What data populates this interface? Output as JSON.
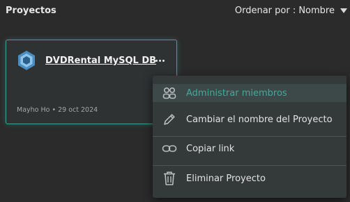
{
  "header": {
    "title": "Proyectos",
    "sort_label": "Ordenar por : Nombre"
  },
  "project_card": {
    "name": "DVDRental MySQL DB",
    "owner": "Mayho Ho",
    "date": "29 oct 2024",
    "meta": "Mayho Ho • 29 oct 2024",
    "logo_icon": "mysql-hexagon-logo",
    "more_icon": "ellipsis-icon"
  },
  "context_menu": {
    "items": [
      {
        "label": "Administrar miembros",
        "icon": "members-icon",
        "active": true
      },
      {
        "label": "Cambiar el nombre del Proyecto",
        "icon": "pencil-icon",
        "active": false
      },
      {
        "label": "Copiar link",
        "icon": "link-icon",
        "active": false
      },
      {
        "label": "Eliminar Proyecto",
        "icon": "trash-icon",
        "active": false
      }
    ]
  },
  "colors": {
    "background": "#2b2b2b",
    "card_bg": "#2e3232",
    "accent": "#46a99b",
    "menu_bg": "#34393a",
    "menu_active_bg": "#3d4849",
    "logo_outer": "#4a8ec4",
    "logo_inner": "#2a5f8c"
  }
}
